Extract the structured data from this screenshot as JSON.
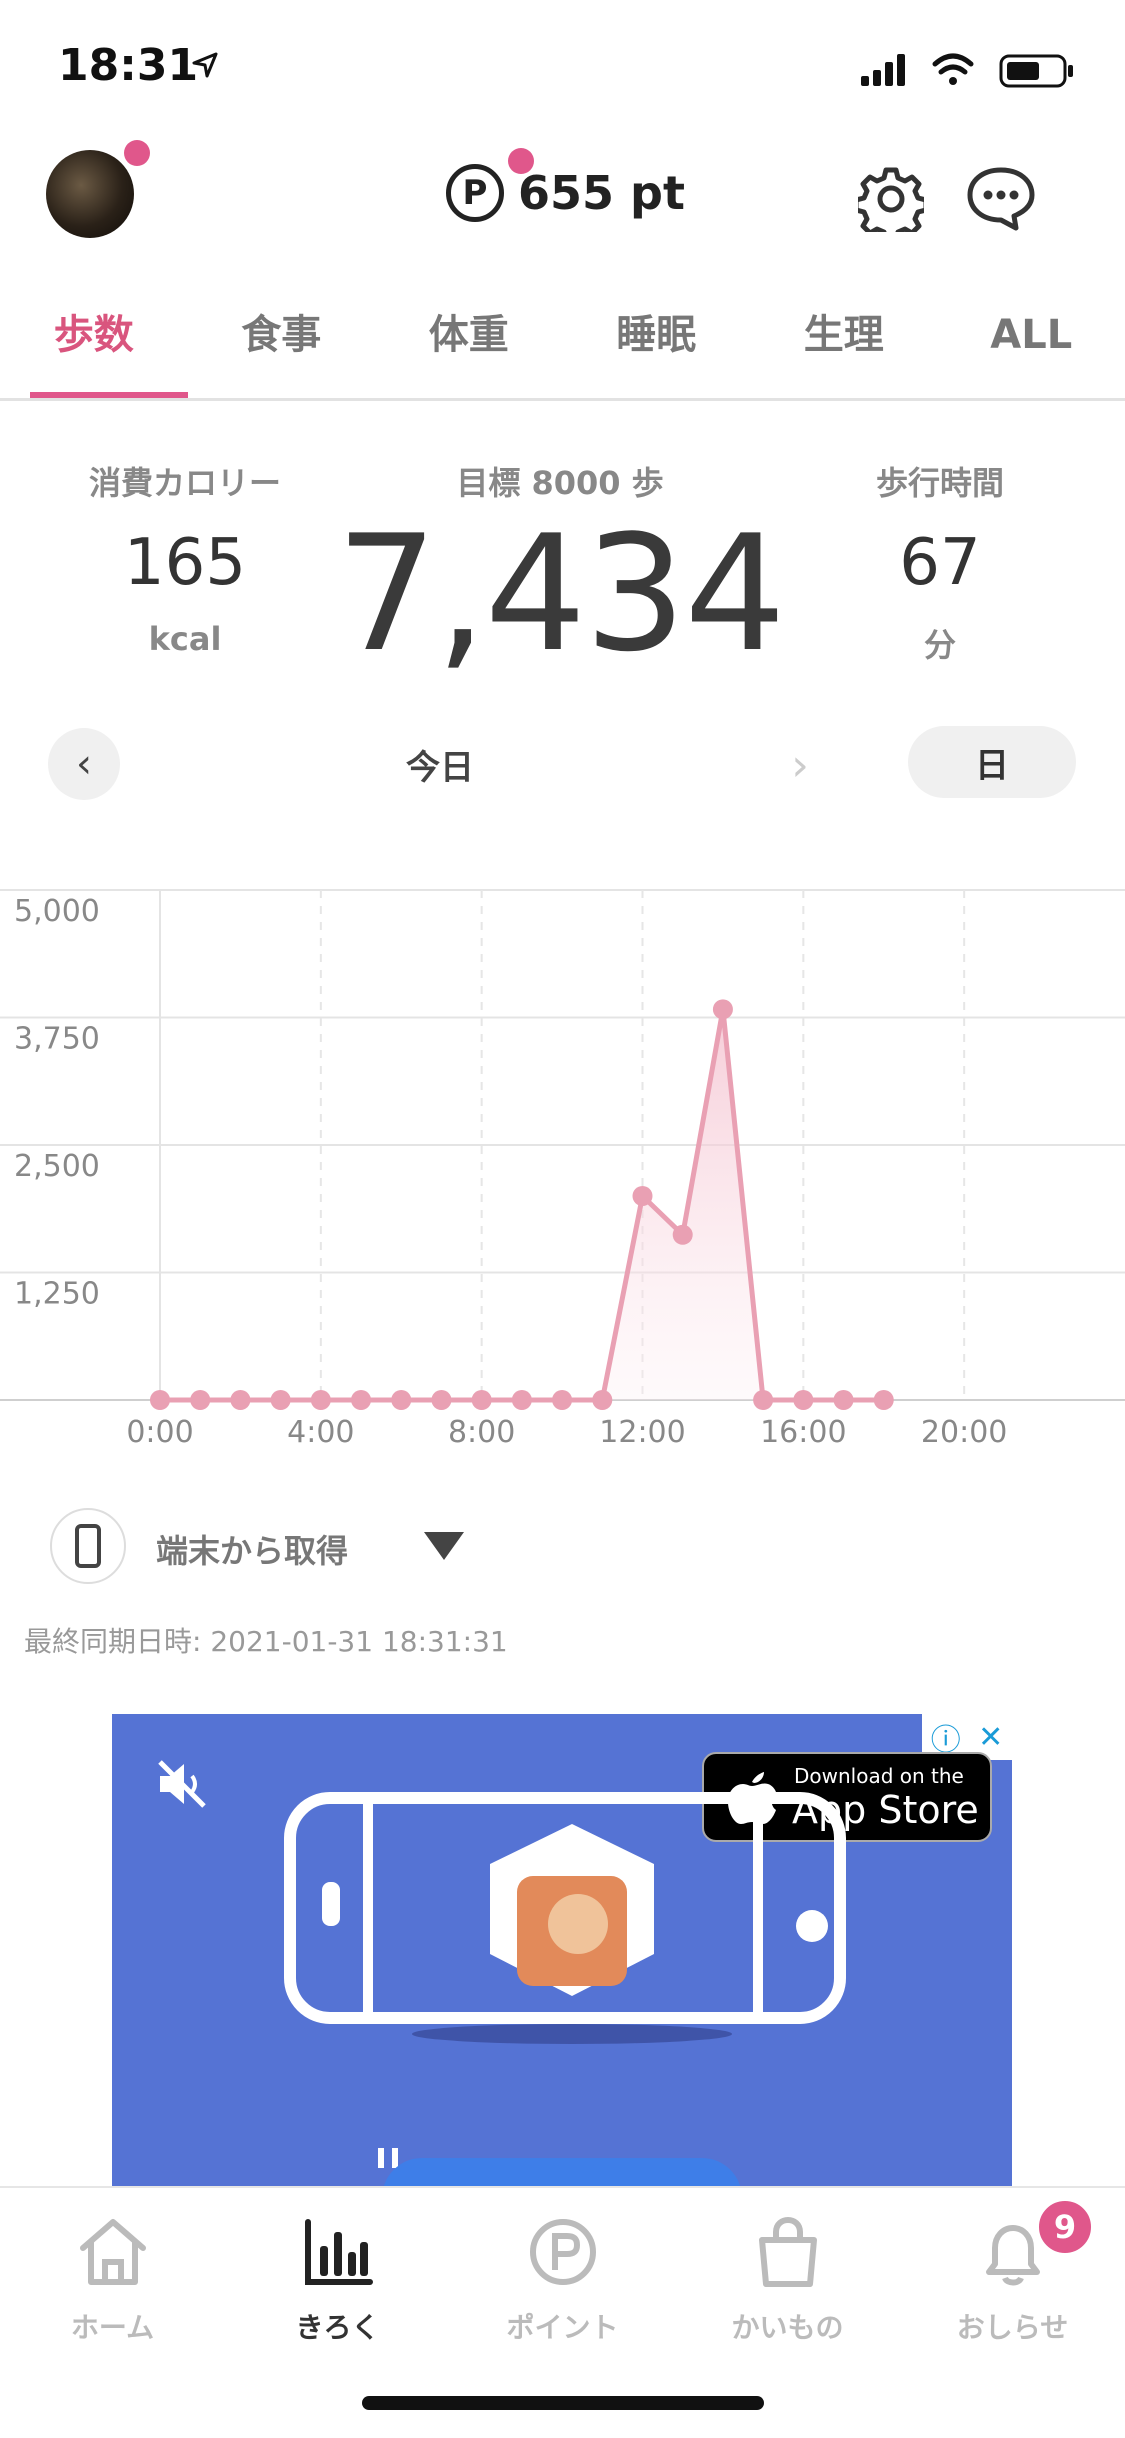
{
  "status_bar": {
    "time": "18:31"
  },
  "header": {
    "points": "655 pt",
    "points_icon": "P"
  },
  "tabs": [
    {
      "label": "歩数",
      "active": true
    },
    {
      "label": "食事"
    },
    {
      "label": "体重"
    },
    {
      "label": "睡眠"
    },
    {
      "label": "生理"
    },
    {
      "label": "ALL"
    }
  ],
  "stats": {
    "calories": {
      "label": "消費カロリー",
      "value": "165",
      "unit": "kcal"
    },
    "goal_label": "目標 8000 歩",
    "steps": "7,434",
    "walk_time": {
      "label": "歩行時間",
      "value": "67",
      "unit": "分"
    }
  },
  "date_nav": {
    "prev": "‹",
    "label": "今日",
    "next": "›",
    "period": "日"
  },
  "chart_data": {
    "type": "line",
    "x": [
      "0:00",
      "1:00",
      "2:00",
      "3:00",
      "4:00",
      "5:00",
      "6:00",
      "7:00",
      "8:00",
      "9:00",
      "10:00",
      "11:00",
      "12:00",
      "13:00",
      "14:00",
      "15:00",
      "16:00",
      "17:00",
      "18:00"
    ],
    "values": [
      0,
      0,
      0,
      0,
      0,
      0,
      0,
      0,
      0,
      0,
      0,
      0,
      2000,
      1620,
      3830,
      0,
      0,
      0,
      0
    ],
    "x_ticks": [
      "0:00",
      "4:00",
      "8:00",
      "12:00",
      "16:00",
      "20:00"
    ],
    "y_ticks": [
      "5,000",
      "3,750",
      "2,500",
      "1,250"
    ],
    "ylim": [
      0,
      5000
    ],
    "xlim": [
      0,
      24
    ],
    "grid": true,
    "color": "#e9a0b3"
  },
  "source": {
    "label": "端末から取得"
  },
  "sync": {
    "text": "最終同期日時:   2021-01-31 18:31:31"
  },
  "ad": {
    "store_small": "Download on the",
    "store_big": "App Store",
    "info": "ⓘ",
    "close": "✕"
  },
  "bottom_nav": [
    {
      "label": "ホーム",
      "icon": "home-icon"
    },
    {
      "label": "きろく",
      "icon": "bar-chart-icon",
      "active": true
    },
    {
      "label": "ポイント",
      "icon": "point-icon"
    },
    {
      "label": "かいもの",
      "icon": "shopping-bag-icon"
    },
    {
      "label": "おしらせ",
      "icon": "bell-icon"
    }
  ],
  "notifications_badge": "9"
}
